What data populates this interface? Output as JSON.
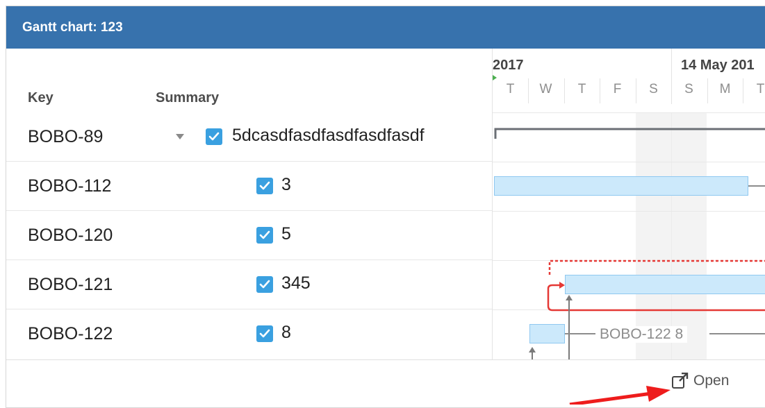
{
  "header": {
    "title": "Gantt chart: 123"
  },
  "columns": {
    "key": "Key",
    "summary": "Summary"
  },
  "timeline": {
    "periods": [
      "2017",
      "14 May 201"
    ],
    "days": [
      "T",
      "W",
      "T",
      "F",
      "S",
      "S",
      "M",
      "T"
    ]
  },
  "rows": [
    {
      "key": "BOBO-89",
      "summary": "5dcasdfasdfasdfasdfasdf",
      "checked": true,
      "expanded": true
    },
    {
      "key": "BOBO-112",
      "summary": "3",
      "checked": true
    },
    {
      "key": "BOBO-120",
      "summary": "5",
      "checked": true
    },
    {
      "key": "BOBO-121",
      "summary": "345",
      "checked": true
    },
    {
      "key": "BOBO-122",
      "summary": "8",
      "checked": true
    }
  ],
  "bars": {
    "bobo122_label": "BOBO-122  8"
  },
  "footer": {
    "open_label": "Open"
  },
  "colors": {
    "header": "#3772ad",
    "bar": "#cce9fb",
    "checkbox": "#3aa0e0",
    "dependency": "#e53935"
  },
  "icons": {
    "expand": "chevron-down-icon",
    "checkbox": "checkbox-checked-icon",
    "open": "external-link-icon"
  }
}
